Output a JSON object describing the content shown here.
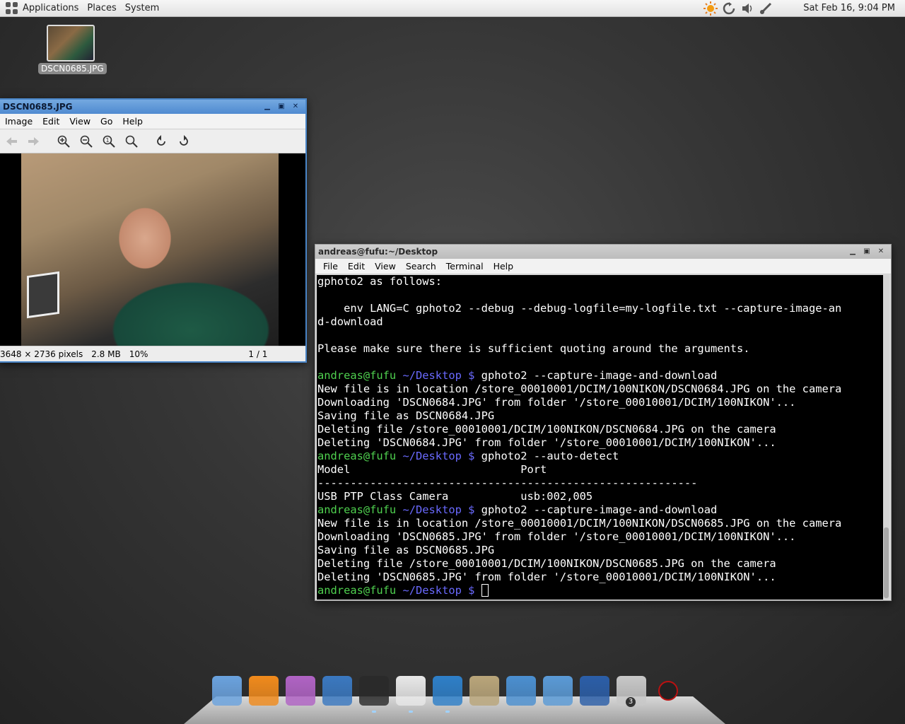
{
  "top_panel": {
    "menus": [
      "Applications",
      "Places",
      "System"
    ],
    "tray_icons": [
      "weather-icon",
      "update-icon",
      "volume-icon",
      "network-icon"
    ],
    "clock": "Sat Feb 16,  9:04 PM"
  },
  "desktop": {
    "icons": [
      {
        "label": "DSCN0685.JPG",
        "icon": "image-thumbnail"
      }
    ]
  },
  "image_viewer": {
    "title": "DSCN0685.JPG",
    "menu": [
      "Image",
      "Edit",
      "View",
      "Go",
      "Help"
    ],
    "toolbar": [
      "back-icon",
      "forward-icon",
      "zoom-in-icon",
      "zoom-out-icon",
      "zoom-normal-icon",
      "zoom-fit-icon",
      "rotate-left-icon",
      "rotate-right-icon"
    ],
    "status": {
      "dimensions": "3648 × 2736 pixels",
      "size": "2.8 MB",
      "zoom": "10%",
      "position": "1 / 1"
    }
  },
  "terminal": {
    "title": "andreas@fufu:~/Desktop",
    "menu": [
      "File",
      "Edit",
      "View",
      "Search",
      "Terminal",
      "Help"
    ],
    "prompt_user": "andreas@fufu",
    "prompt_path": " ~/Desktop $ ",
    "lines": [
      {
        "type": "text",
        "text": "gphoto2 as follows:"
      },
      {
        "type": "text",
        "text": ""
      },
      {
        "type": "text",
        "text": "    env LANG=C gphoto2 --debug --debug-logfile=my-logfile.txt --capture-image-an"
      },
      {
        "type": "text",
        "text": "d-download"
      },
      {
        "type": "text",
        "text": ""
      },
      {
        "type": "text",
        "text": "Please make sure there is sufficient quoting around the arguments."
      },
      {
        "type": "text",
        "text": ""
      },
      {
        "type": "prompt",
        "text": "gphoto2 --capture-image-and-download"
      },
      {
        "type": "text",
        "text": "New file is in location /store_00010001/DCIM/100NIKON/DSCN0684.JPG on the camera"
      },
      {
        "type": "text",
        "text": "Downloading 'DSCN0684.JPG' from folder '/store_00010001/DCIM/100NIKON'..."
      },
      {
        "type": "text",
        "text": "Saving file as DSCN0684.JPG"
      },
      {
        "type": "text",
        "text": "Deleting file /store_00010001/DCIM/100NIKON/DSCN0684.JPG on the camera"
      },
      {
        "type": "text",
        "text": "Deleting 'DSCN0684.JPG' from folder '/store_00010001/DCIM/100NIKON'..."
      },
      {
        "type": "prompt",
        "text": "gphoto2 --auto-detect"
      },
      {
        "type": "text",
        "text": "Model                          Port"
      },
      {
        "type": "text",
        "text": "----------------------------------------------------------"
      },
      {
        "type": "text",
        "text": "USB PTP Class Camera           usb:002,005"
      },
      {
        "type": "prompt",
        "text": "gphoto2 --capture-image-and-download"
      },
      {
        "type": "text",
        "text": "New file is in location /store_00010001/DCIM/100NIKON/DSCN0685.JPG on the camera"
      },
      {
        "type": "text",
        "text": "Downloading 'DSCN0685.JPG' from folder '/store_00010001/DCIM/100NIKON'..."
      },
      {
        "type": "text",
        "text": "Saving file as DSCN0685.JPG"
      },
      {
        "type": "text",
        "text": "Deleting file /store_00010001/DCIM/100NIKON/DSCN0685.JPG on the camera"
      },
      {
        "type": "text",
        "text": "Deleting 'DSCN0685.JPG' from folder '/store_00010001/DCIM/100NIKON'..."
      },
      {
        "type": "cursor",
        "text": ""
      }
    ]
  },
  "dock": {
    "items": [
      {
        "name": "chromium-icon",
        "color": "#6aa2de",
        "running": false
      },
      {
        "name": "vlc-icon",
        "color": "#f08a1c",
        "running": false
      },
      {
        "name": "pidgin-icon",
        "color": "#b063c4",
        "running": false
      },
      {
        "name": "text-editor-icon",
        "color": "#3a78c0",
        "running": false
      },
      {
        "name": "terminal-icon",
        "color": "#2a2a2a",
        "running": true
      },
      {
        "name": "image-viewer-icon",
        "color": "#e8e8e8",
        "running": true
      },
      {
        "name": "blender-icon",
        "color": "#2e7fc8",
        "running": true
      },
      {
        "name": "gimp-icon",
        "color": "#b9a57a",
        "running": false
      },
      {
        "name": "home-folder-icon",
        "color": "#4b8fd0",
        "running": false
      },
      {
        "name": "documents-folder-icon",
        "color": "#5a9ad6",
        "running": false
      },
      {
        "name": "system-monitor-icon",
        "color": "#2b5ea8",
        "running": false
      },
      {
        "name": "trash-icon",
        "color": "#c8c8c8",
        "running": false,
        "badge": "3"
      },
      {
        "name": "dock-settings-icon",
        "color": "#b11",
        "running": false
      }
    ]
  }
}
